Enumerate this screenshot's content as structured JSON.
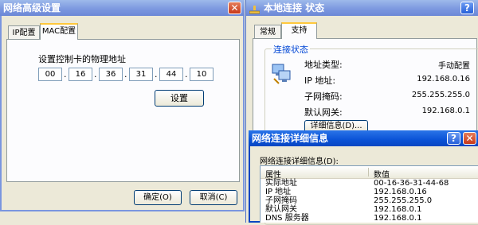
{
  "advanced_dialog": {
    "title": "网络高级设置",
    "tabs": [
      "IP配置",
      "MAC配置"
    ],
    "mac_label": "设置控制卡的物理地址",
    "mac_octets": [
      "00",
      "16",
      "36",
      "31",
      "44",
      "10"
    ],
    "set_button": "设置",
    "ok_button": "确定(O)",
    "cancel_button": "取消(C)"
  },
  "status_window": {
    "title": "本地连接 状态",
    "tabs": [
      "常规",
      "支持"
    ],
    "group_title": "连接状态",
    "rows": [
      {
        "label": "地址类型:",
        "value": "手动配置"
      },
      {
        "label": "IP 地址:",
        "value": "192.168.0.16"
      },
      {
        "label": "子网掩码:",
        "value": "255.255.255.0"
      },
      {
        "label": "默认网关:",
        "value": "192.168.0.1"
      }
    ],
    "details_button": "详细信息(D)..."
  },
  "details_dialog": {
    "title": "网络连接详细信息",
    "subtitle": "网络连接详细信息(D):",
    "col_property": "属性",
    "col_value": "数值",
    "rows": [
      {
        "prop": "实际地址",
        "value": "00-16-36-31-44-68"
      },
      {
        "prop": "IP 地址",
        "value": "192.168.0.16"
      },
      {
        "prop": "子网掩码",
        "value": "255.255.255.0"
      },
      {
        "prop": "默认网关",
        "value": "192.168.0.1"
      },
      {
        "prop": "DNS 服务器",
        "value": "192.168.0.1"
      }
    ]
  }
}
